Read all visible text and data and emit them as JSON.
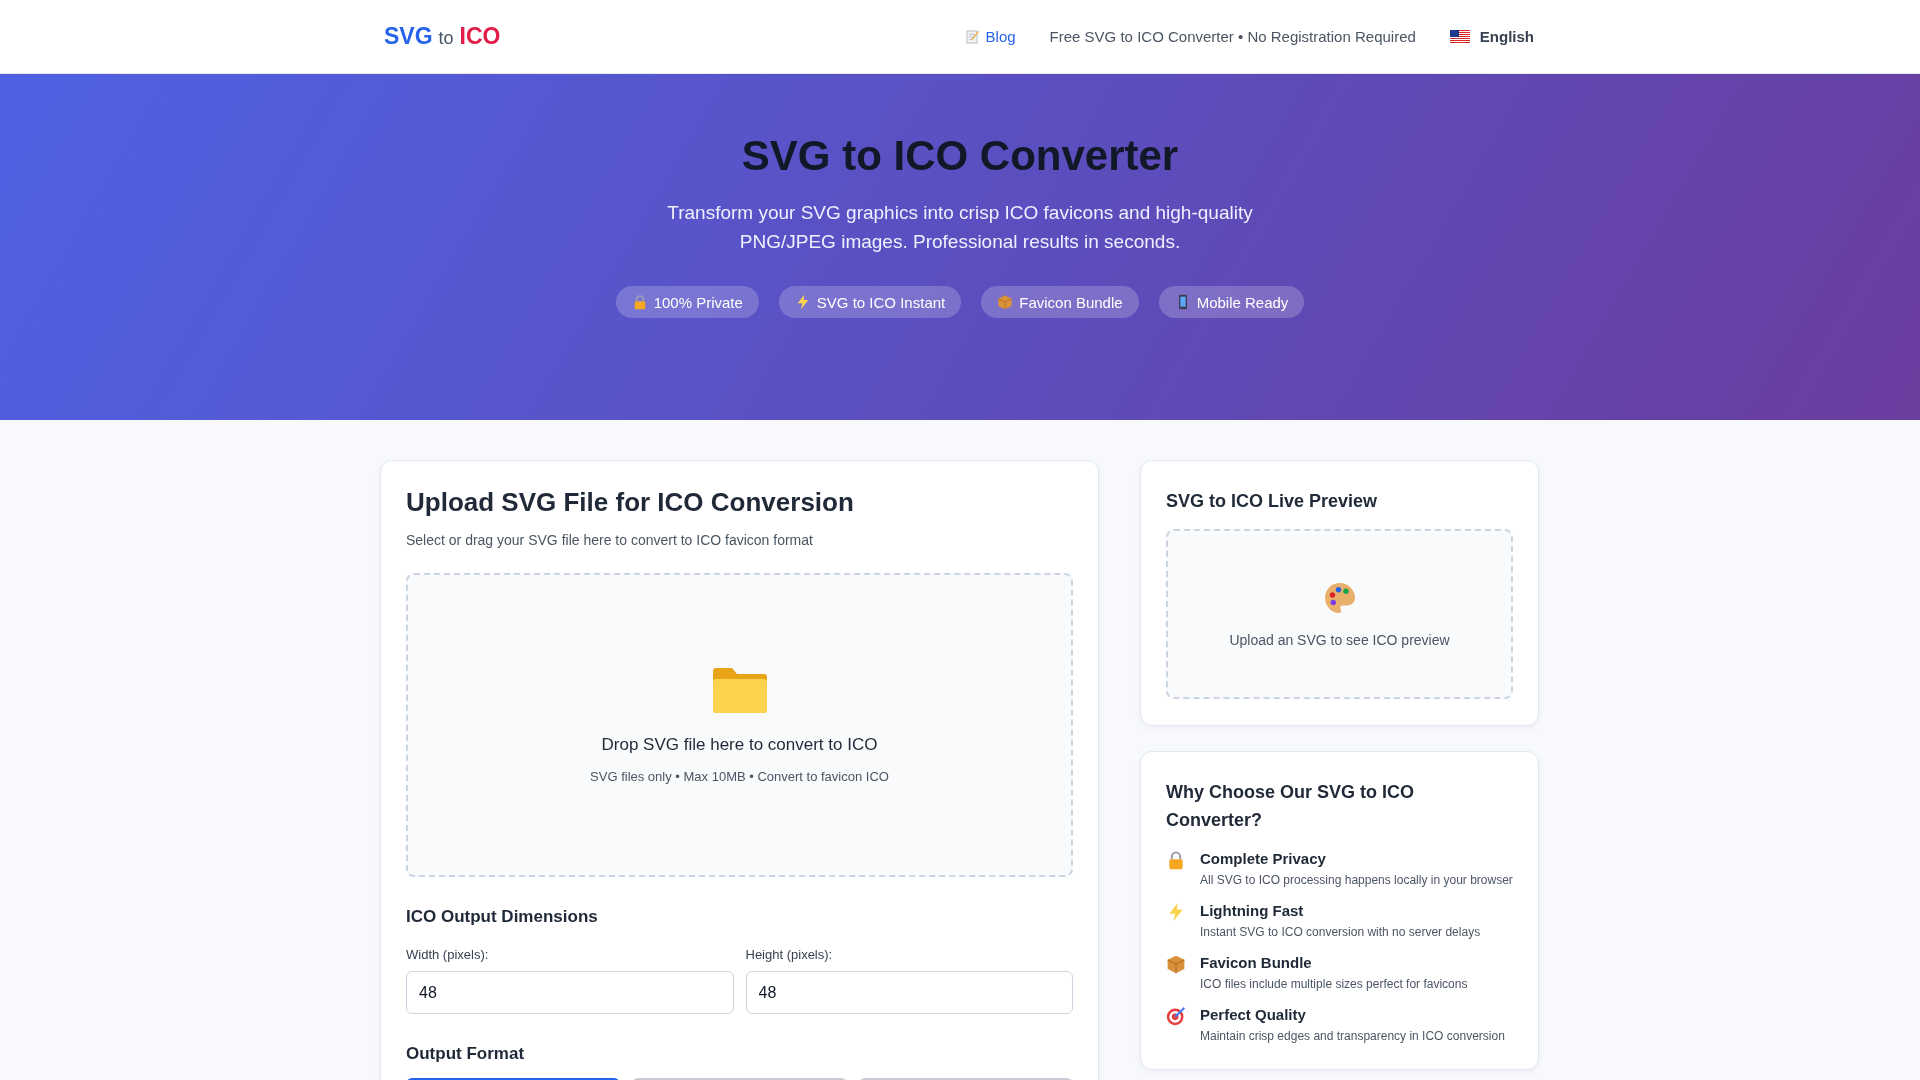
{
  "header": {
    "logo": [
      {
        "text": "SVG",
        "kind": "primary"
      },
      {
        "text": "to",
        "kind": "small"
      },
      {
        "text": "ICO",
        "kind": "accent"
      }
    ],
    "nav": [
      {
        "kind": "link",
        "label": "Blog"
      },
      {
        "kind": "text",
        "label": "Free SVG to ICO Converter • No Registration Required"
      },
      {
        "kind": "language",
        "label": "English"
      }
    ]
  },
  "hero": {
    "title": "SVG to ICO Converter",
    "subtitle": "Transform your SVG graphics into crisp ICO favicons and high-quality PNG/JPEG images. Professional results in seconds.",
    "badges": [
      {
        "label": "100% Private"
      },
      {
        "label": "SVG to ICO Instant"
      },
      {
        "label": "Favicon Bundle"
      },
      {
        "label": "Mobile Ready"
      }
    ]
  },
  "upload_card": {
    "title": "Upload SVG File for ICO Conversion",
    "subtitle": "Select or drag your SVG file here to convert to ICO favicon format",
    "dropzone": {
      "title": "Drop SVG file here to convert to ICO",
      "hint": "SVG files only • Max 10MB • Convert to favicon ICO"
    },
    "dimensions_title": "ICO Output Dimensions",
    "fields": [
      {
        "label": "Width (pixels):",
        "value": "48"
      },
      {
        "label": "Height (pixels):",
        "value": "48"
      }
    ],
    "format_title": "Output Format",
    "format_buttons": [
      {
        "selected": true
      },
      {
        "selected": false
      },
      {
        "selected": false
      }
    ]
  },
  "preview_card": {
    "title": "SVG to ICO Live Preview",
    "placeholder": "Upload an SVG to see ICO preview"
  },
  "why_card": {
    "title": "Why Choose Our SVG to ICO Converter?",
    "items": [
      {
        "title": "Complete Privacy",
        "text": "All SVG to ICO processing happens locally in your browser"
      },
      {
        "title": "Lightning Fast",
        "text": "Instant SVG to ICO conversion with no server delays"
      },
      {
        "title": "Favicon Bundle",
        "text": "ICO files include multiple sizes perfect for favicons"
      },
      {
        "title": "Perfect Quality",
        "text": "Maintain crisp edges and transparency in ICO conversion"
      }
    ]
  }
}
